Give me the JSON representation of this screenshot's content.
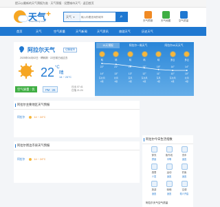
{
  "topbar": {
    "text": "提示以最新的天气预报为准 · 天气预报 · 设置城市天气 · 返回首页"
  },
  "header": {
    "logo_name": "天气",
    "logo_plus": "+",
    "logo_url": "www.tianqi.com",
    "search": {
      "select_value": "天气",
      "placeholder": "输入你要查询的城市"
    },
    "icons": [
      {
        "label": "天气预报",
        "icon": "calendar-icon",
        "color": "#f08a24"
      },
      {
        "label": "天气地图",
        "icon": "map-icon",
        "color": "#3fae43"
      },
      {
        "label": "空气质量",
        "icon": "air-icon",
        "color": "#1f78d1"
      }
    ]
  },
  "nav": {
    "items": [
      "首页",
      "天气",
      "空气质量",
      "天气新闻",
      "天气资讯",
      "旅游天气",
      "历史天气"
    ]
  },
  "current": {
    "city_title": "阿拉尔天气",
    "tag": "切换城市",
    "published": "2025年04月02日  ·  晴转阴  ·  22日前已经过去",
    "temp": "22",
    "temp_unit": "°C",
    "condition": "晴",
    "range": "14 ~ 24°C",
    "stats": [
      "湿度 : 22%",
      "风向 : 东北风 2级",
      "紫外线 : 中等"
    ],
    "sun_times": [
      "日出 07:41",
      "日落 21:24"
    ]
  },
  "aq": {
    "label": "空气质量 : 优",
    "pm": "PM : 26"
  },
  "forecast": {
    "tabs": [
      "15天预报",
      "阿拉尔一周天气",
      "阿拉尔40天天气"
    ],
    "days": [
      {
        "cond": "晴",
        "hi": "22°",
        "lo": "14°",
        "wind": "东北风",
        "level": "2级",
        "hi_val": 22,
        "lo_val": 14
      },
      {
        "cond": "晴",
        "hi": "21°",
        "lo": "13°",
        "wind": "北风",
        "level": "2级",
        "hi_val": 21,
        "lo_val": 13
      },
      {
        "cond": "晴",
        "hi": "19°",
        "lo": "13°",
        "wind": "东风",
        "level": "2级",
        "hi_val": 19,
        "lo_val": 13
      },
      {
        "cond": "晴",
        "hi": "17°",
        "lo": "12°",
        "wind": "东北风",
        "level": "2级",
        "hi_val": 17,
        "lo_val": 12
      },
      {
        "cond": "晴",
        "hi": "15°",
        "lo": "11°",
        "wind": "东风",
        "level": "1级",
        "hi_val": 15,
        "lo_val": 11
      },
      {
        "cond": "多云",
        "hi": "14°",
        "lo": "10°",
        "wind": "东北风",
        "level": "2级",
        "hi_val": 14,
        "lo_val": 10
      },
      {
        "cond": "多云",
        "hi": "14°",
        "lo": "10°",
        "wind": "北风",
        "level": "2级",
        "hi_val": 14,
        "lo_val": 10
      }
    ]
  },
  "section1": {
    "title": "阿拉尔主要地区天气预报",
    "rows": [
      {
        "city": "阿拉尔",
        "temp": "14 ~ 24°C"
      }
    ]
  },
  "section2": {
    "title": "阿拉尔周边市县天气预报",
    "rows": [
      {
        "city": "阿拉尔",
        "temp": "14 ~ 24°C"
      }
    ]
  },
  "side": {
    "title": "阿拉尔今日生活指数",
    "items": [
      {
        "label": "穿衣",
        "status": "舒适"
      },
      {
        "label": "紫外线",
        "status": "中等"
      },
      {
        "label": "洗车",
        "status": "适宜"
      },
      {
        "label": "感冒",
        "status": "少发"
      },
      {
        "label": "运动",
        "status": "适宜"
      },
      {
        "label": "钓鱼",
        "status": "适宜"
      },
      {
        "label": "旅游",
        "status": "适宜"
      },
      {
        "label": "晾晒",
        "status": "适宜"
      },
      {
        "label": "空调",
        "status": "较少开启"
      }
    ],
    "footer": "阿拉尔天气空气质量"
  }
}
